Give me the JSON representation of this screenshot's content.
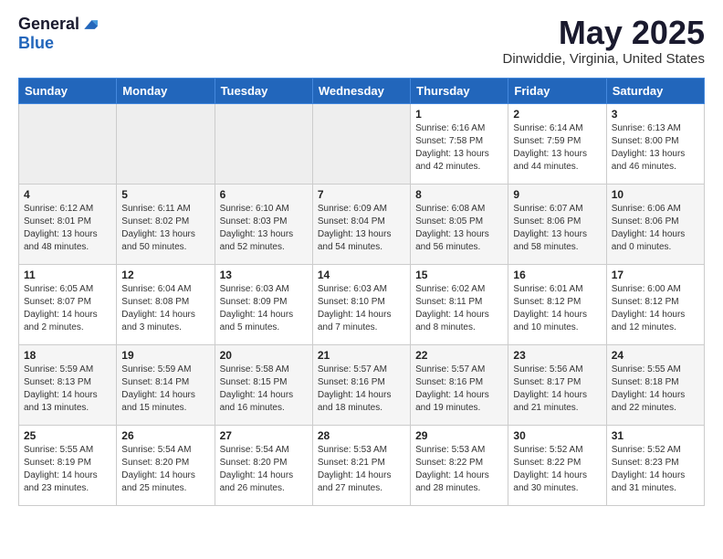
{
  "header": {
    "logo_general": "General",
    "logo_blue": "Blue",
    "month_title": "May 2025",
    "location": "Dinwiddie, Virginia, United States"
  },
  "days_of_week": [
    "Sunday",
    "Monday",
    "Tuesday",
    "Wednesday",
    "Thursday",
    "Friday",
    "Saturday"
  ],
  "weeks": [
    [
      {
        "date": "",
        "info": ""
      },
      {
        "date": "",
        "info": ""
      },
      {
        "date": "",
        "info": ""
      },
      {
        "date": "",
        "info": ""
      },
      {
        "date": "1",
        "info": "Sunrise: 6:16 AM\nSunset: 7:58 PM\nDaylight: 13 hours\nand 42 minutes."
      },
      {
        "date": "2",
        "info": "Sunrise: 6:14 AM\nSunset: 7:59 PM\nDaylight: 13 hours\nand 44 minutes."
      },
      {
        "date": "3",
        "info": "Sunrise: 6:13 AM\nSunset: 8:00 PM\nDaylight: 13 hours\nand 46 minutes."
      }
    ],
    [
      {
        "date": "4",
        "info": "Sunrise: 6:12 AM\nSunset: 8:01 PM\nDaylight: 13 hours\nand 48 minutes."
      },
      {
        "date": "5",
        "info": "Sunrise: 6:11 AM\nSunset: 8:02 PM\nDaylight: 13 hours\nand 50 minutes."
      },
      {
        "date": "6",
        "info": "Sunrise: 6:10 AM\nSunset: 8:03 PM\nDaylight: 13 hours\nand 52 minutes."
      },
      {
        "date": "7",
        "info": "Sunrise: 6:09 AM\nSunset: 8:04 PM\nDaylight: 13 hours\nand 54 minutes."
      },
      {
        "date": "8",
        "info": "Sunrise: 6:08 AM\nSunset: 8:05 PM\nDaylight: 13 hours\nand 56 minutes."
      },
      {
        "date": "9",
        "info": "Sunrise: 6:07 AM\nSunset: 8:06 PM\nDaylight: 13 hours\nand 58 minutes."
      },
      {
        "date": "10",
        "info": "Sunrise: 6:06 AM\nSunset: 8:06 PM\nDaylight: 14 hours\nand 0 minutes."
      }
    ],
    [
      {
        "date": "11",
        "info": "Sunrise: 6:05 AM\nSunset: 8:07 PM\nDaylight: 14 hours\nand 2 minutes."
      },
      {
        "date": "12",
        "info": "Sunrise: 6:04 AM\nSunset: 8:08 PM\nDaylight: 14 hours\nand 3 minutes."
      },
      {
        "date": "13",
        "info": "Sunrise: 6:03 AM\nSunset: 8:09 PM\nDaylight: 14 hours\nand 5 minutes."
      },
      {
        "date": "14",
        "info": "Sunrise: 6:03 AM\nSunset: 8:10 PM\nDaylight: 14 hours\nand 7 minutes."
      },
      {
        "date": "15",
        "info": "Sunrise: 6:02 AM\nSunset: 8:11 PM\nDaylight: 14 hours\nand 8 minutes."
      },
      {
        "date": "16",
        "info": "Sunrise: 6:01 AM\nSunset: 8:12 PM\nDaylight: 14 hours\nand 10 minutes."
      },
      {
        "date": "17",
        "info": "Sunrise: 6:00 AM\nSunset: 8:12 PM\nDaylight: 14 hours\nand 12 minutes."
      }
    ],
    [
      {
        "date": "18",
        "info": "Sunrise: 5:59 AM\nSunset: 8:13 PM\nDaylight: 14 hours\nand 13 minutes."
      },
      {
        "date": "19",
        "info": "Sunrise: 5:59 AM\nSunset: 8:14 PM\nDaylight: 14 hours\nand 15 minutes."
      },
      {
        "date": "20",
        "info": "Sunrise: 5:58 AM\nSunset: 8:15 PM\nDaylight: 14 hours\nand 16 minutes."
      },
      {
        "date": "21",
        "info": "Sunrise: 5:57 AM\nSunset: 8:16 PM\nDaylight: 14 hours\nand 18 minutes."
      },
      {
        "date": "22",
        "info": "Sunrise: 5:57 AM\nSunset: 8:16 PM\nDaylight: 14 hours\nand 19 minutes."
      },
      {
        "date": "23",
        "info": "Sunrise: 5:56 AM\nSunset: 8:17 PM\nDaylight: 14 hours\nand 21 minutes."
      },
      {
        "date": "24",
        "info": "Sunrise: 5:55 AM\nSunset: 8:18 PM\nDaylight: 14 hours\nand 22 minutes."
      }
    ],
    [
      {
        "date": "25",
        "info": "Sunrise: 5:55 AM\nSunset: 8:19 PM\nDaylight: 14 hours\nand 23 minutes."
      },
      {
        "date": "26",
        "info": "Sunrise: 5:54 AM\nSunset: 8:20 PM\nDaylight: 14 hours\nand 25 minutes."
      },
      {
        "date": "27",
        "info": "Sunrise: 5:54 AM\nSunset: 8:20 PM\nDaylight: 14 hours\nand 26 minutes."
      },
      {
        "date": "28",
        "info": "Sunrise: 5:53 AM\nSunset: 8:21 PM\nDaylight: 14 hours\nand 27 minutes."
      },
      {
        "date": "29",
        "info": "Sunrise: 5:53 AM\nSunset: 8:22 PM\nDaylight: 14 hours\nand 28 minutes."
      },
      {
        "date": "30",
        "info": "Sunrise: 5:52 AM\nSunset: 8:22 PM\nDaylight: 14 hours\nand 30 minutes."
      },
      {
        "date": "31",
        "info": "Sunrise: 5:52 AM\nSunset: 8:23 PM\nDaylight: 14 hours\nand 31 minutes."
      }
    ]
  ]
}
